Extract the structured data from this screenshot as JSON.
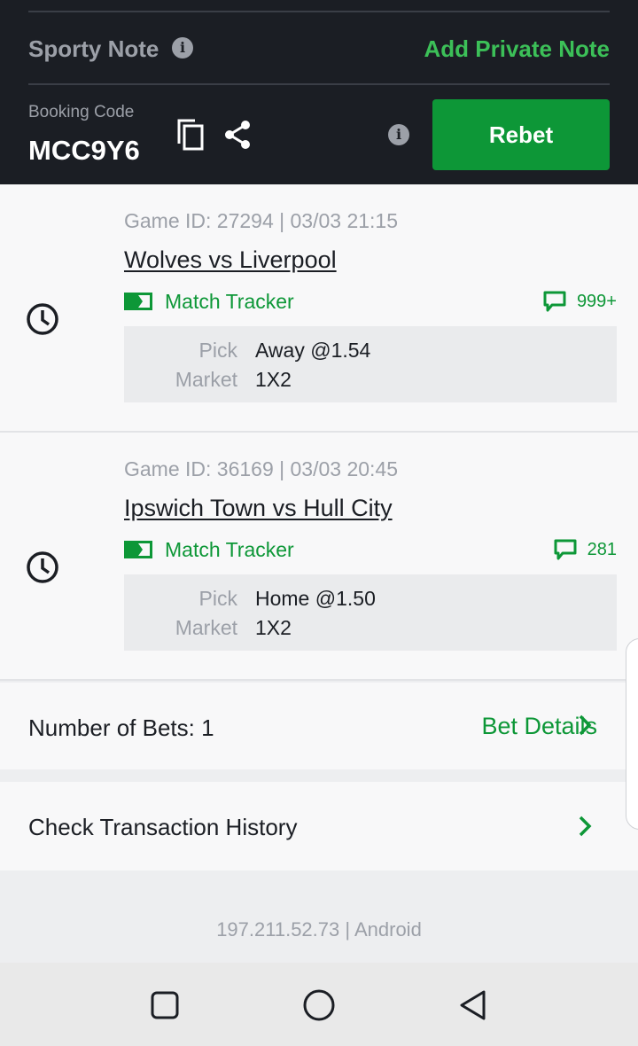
{
  "header": {
    "note_title": "Sporty Note",
    "add_note": "Add Private Note",
    "booking_label": "Booking Code",
    "booking_code": "MCC9Y6",
    "info_glyph": "i",
    "rebet": "Rebet"
  },
  "games": [
    {
      "meta": "Game ID: 27294 | 03/03 21:15",
      "title": "Wolves vs Liverpool",
      "tracker": "Match Tracker",
      "comments": "999+",
      "pick_label": "Pick",
      "pick_value": "Away @1.54",
      "market_label": "Market",
      "market_value": "1X2"
    },
    {
      "meta": "Game ID: 36169 | 03/03 20:45",
      "title": "Ipswich Town vs Hull City",
      "tracker": "Match Tracker",
      "comments": "281",
      "pick_label": "Pick",
      "pick_value": "Home @1.50",
      "market_label": "Market",
      "market_value": "1X2"
    }
  ],
  "bets": {
    "count_text": "Number of Bets: 1",
    "details_link": "Bet Details"
  },
  "history": {
    "label": "Check Transaction History"
  },
  "footer": {
    "info": "197.211.52.73 | Android"
  },
  "icons": {
    "info": "info-icon",
    "copy": "copy-icon",
    "share": "share-icon",
    "clock": "clock-icon",
    "tracker": "match-tracker-icon",
    "comment": "comment-icon",
    "chevron": "chevron-right-icon",
    "nav": [
      "recent-apps-icon",
      "home-icon",
      "back-icon"
    ]
  },
  "colors": {
    "header_bg": "#1b1e24",
    "accent_green": "#0d9737",
    "note_green": "#3cc058",
    "muted_text": "#9ca0a8"
  }
}
